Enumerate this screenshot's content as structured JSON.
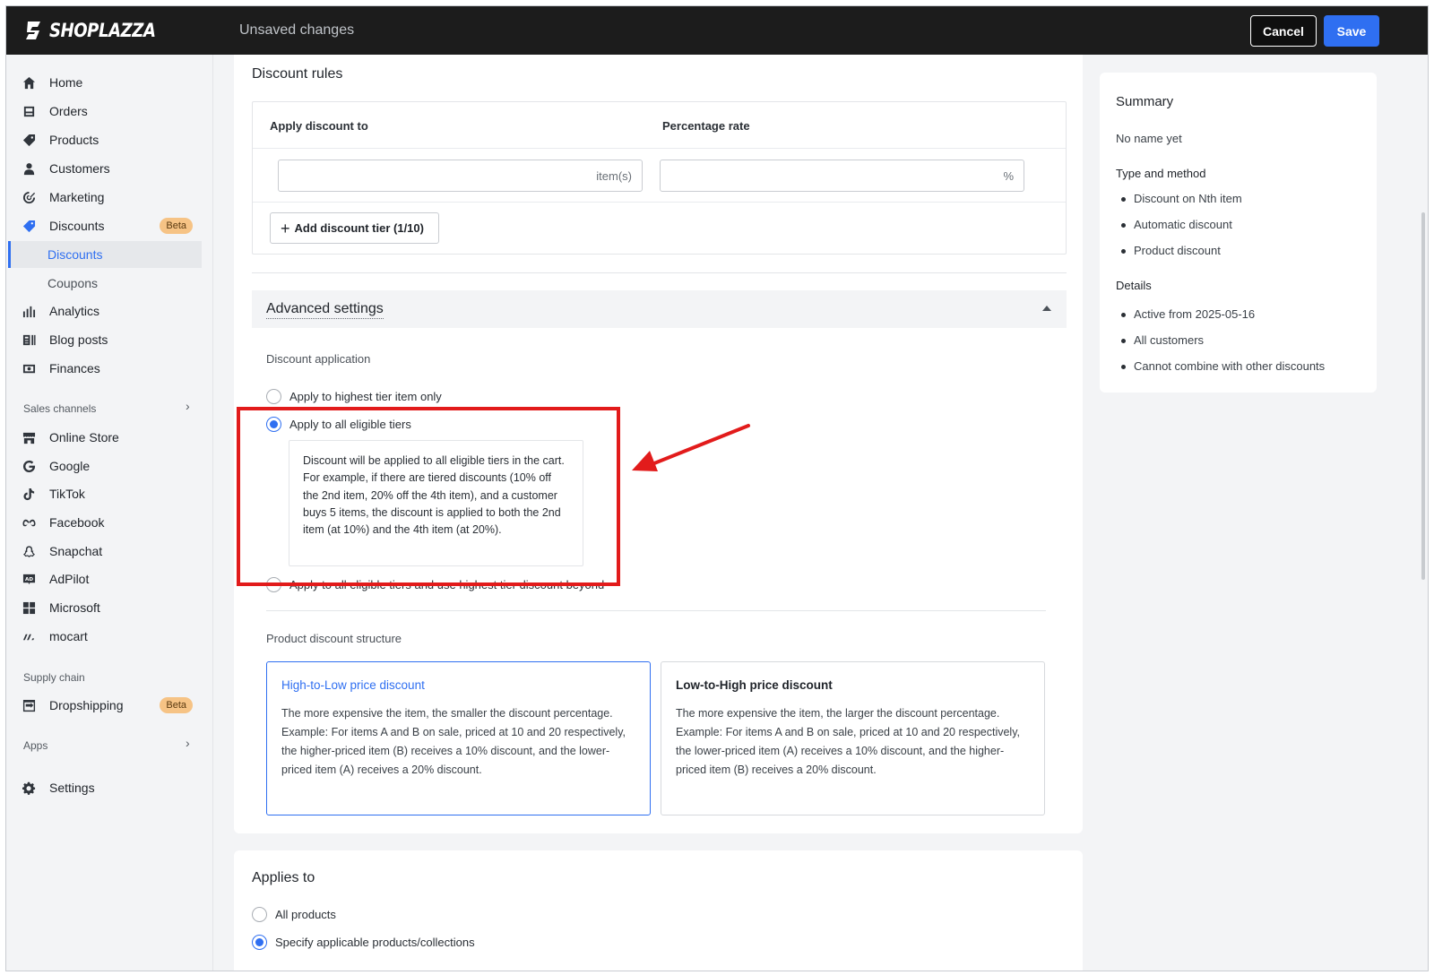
{
  "topbar": {
    "brand": "SHOPLAZZA",
    "status": "Unsaved changes",
    "cancel_label": "Cancel",
    "save_label": "Save"
  },
  "sidebar": {
    "items": [
      {
        "label": "Home",
        "icon": "home-icon"
      },
      {
        "label": "Orders",
        "icon": "orders-icon"
      },
      {
        "label": "Products",
        "icon": "tag-icon"
      },
      {
        "label": "Customers",
        "icon": "person-icon"
      },
      {
        "label": "Marketing",
        "icon": "target-icon"
      },
      {
        "label": "Discounts",
        "icon": "discount-tag-icon",
        "badge": "Beta"
      },
      {
        "label": "Discounts",
        "sub": true,
        "active": true
      },
      {
        "label": "Coupons",
        "sub": true
      },
      {
        "label": "Analytics",
        "icon": "bar-chart-icon"
      },
      {
        "label": "Blog posts",
        "icon": "blog-icon"
      },
      {
        "label": "Finances",
        "icon": "finances-icon"
      }
    ],
    "sales_channels_label": "Sales channels",
    "channels": [
      {
        "label": "Online Store",
        "icon": "store-icon"
      },
      {
        "label": "Google",
        "icon": "google-icon"
      },
      {
        "label": "TikTok",
        "icon": "tiktok-icon"
      },
      {
        "label": "Facebook",
        "icon": "meta-icon"
      },
      {
        "label": "Snapchat",
        "icon": "snapchat-icon"
      },
      {
        "label": "AdPilot",
        "icon": "adpilot-icon"
      },
      {
        "label": "Microsoft",
        "icon": "microsoft-icon"
      },
      {
        "label": "mocart",
        "icon": "mocart-icon"
      }
    ],
    "supply_chain_label": "Supply chain",
    "supply": [
      {
        "label": "Dropshipping",
        "icon": "dropshipping-icon",
        "badge": "Beta"
      }
    ],
    "apps_label": "Apps",
    "settings_label": "Settings"
  },
  "rules": {
    "title": "Discount rules",
    "col_apply": "Apply discount to",
    "col_rate": "Percentage rate",
    "items_suffix": "item(s)",
    "rate_suffix": "%",
    "add_tier": "Add discount tier (1/10)"
  },
  "advanced": {
    "title": "Advanced settings",
    "application_label": "Discount application",
    "options": [
      {
        "label": "Apply to highest tier item only",
        "checked": false
      },
      {
        "label": "Apply to all eligible tiers",
        "checked": true
      },
      {
        "label": "Apply to all eligible tiers and use highest tier discount beyond",
        "checked": false
      }
    ],
    "description": "Discount will be applied to all eligible tiers in the cart. For example, if there are tiered discounts (10% off the 2nd item, 20% off the 4th item), and a customer buys 5 items, the discount is applied to both the 2nd item (at 10%) and the 4th item (at 20%).",
    "structure_label": "Product discount structure",
    "structures": [
      {
        "title": "High-to-Low price discount",
        "body": "The more expensive the item, the smaller the discount percentage.\nExample: For items A and B on sale, priced at 10 and 20 respectively, the higher-priced item (B) receives a 10% discount, and the lower-priced item (A) receives a 20% discount.",
        "selected": true
      },
      {
        "title": "Low-to-High price discount",
        "body": "The more expensive the item, the larger the discount percentage.\nExample: For items A and B on sale, priced at 10 and 20 respectively, the lower-priced item (A) receives a 10% discount, and the higher-priced item (B) receives a 20% discount.",
        "selected": false
      }
    ]
  },
  "applies_to": {
    "title": "Applies to",
    "options": [
      {
        "label": "All products",
        "checked": false
      },
      {
        "label": "Specify applicable products/collections",
        "checked": true
      }
    ]
  },
  "summary": {
    "title": "Summary",
    "name": "No name yet",
    "type_label": "Type and method",
    "type_items": [
      "Discount on Nth item",
      "Automatic discount",
      "Product discount"
    ],
    "details_label": "Details",
    "details_items": [
      "Active from 2025-05-16",
      "All customers",
      "Cannot combine with other discounts"
    ]
  },
  "colors": {
    "accent": "#2f6ff1",
    "highlight": "#e21b1b",
    "badge": "#f6c385",
    "topbar": "#1c1c1c"
  }
}
